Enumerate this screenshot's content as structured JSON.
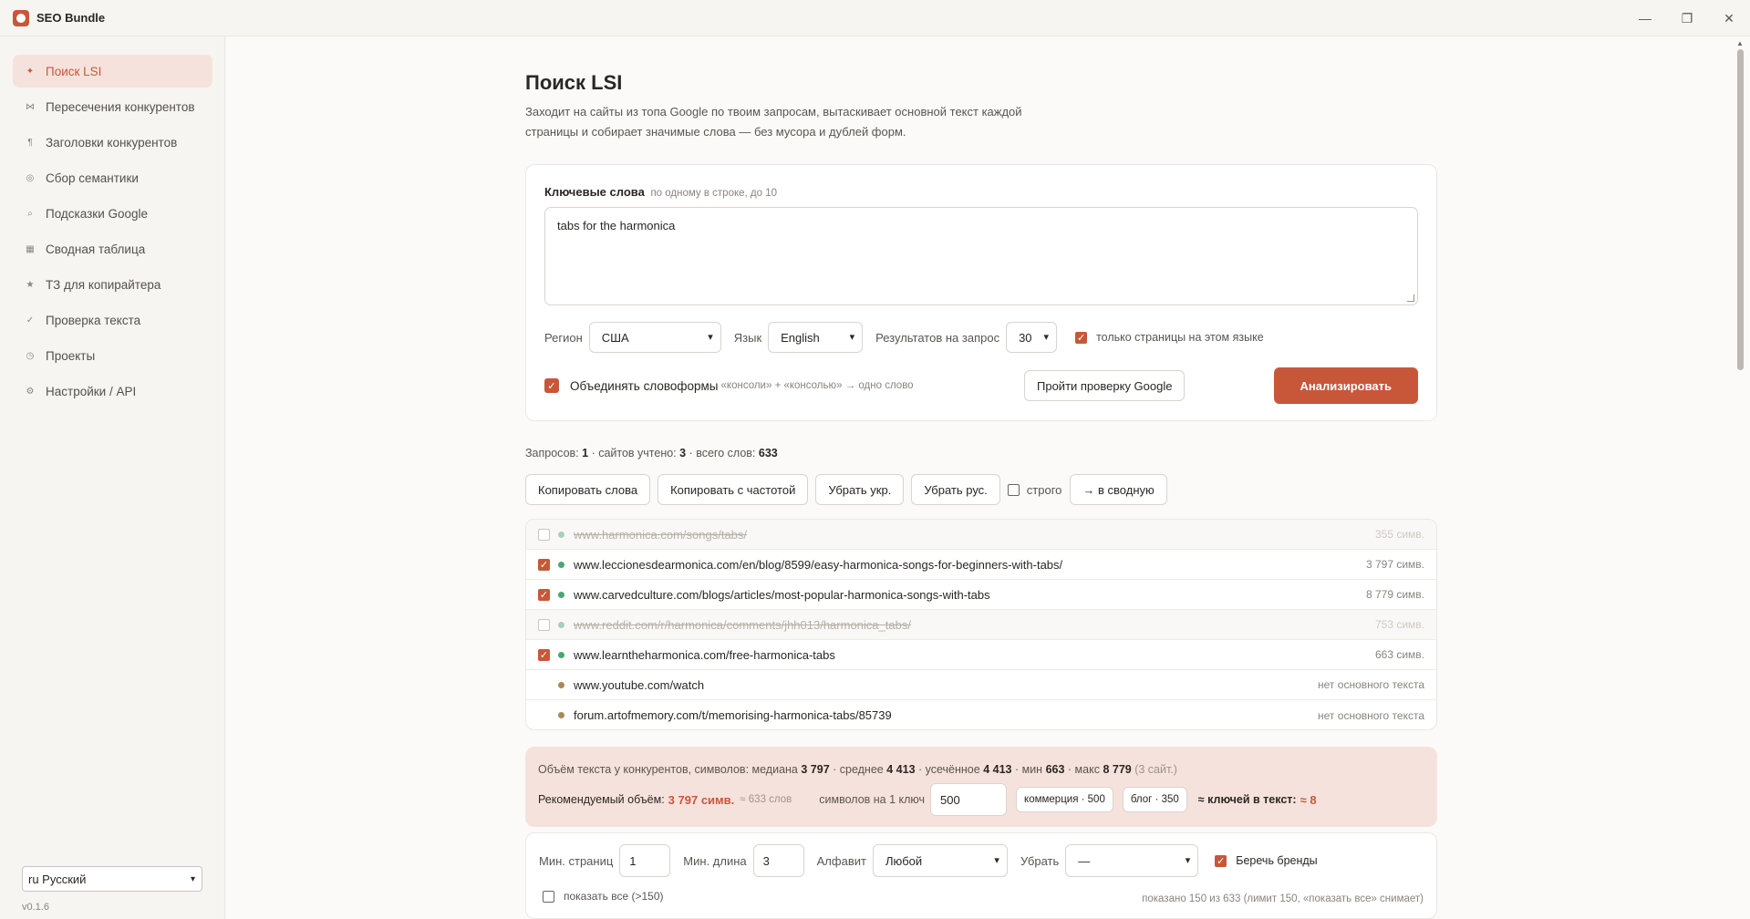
{
  "app": {
    "title": "SEO Bundle",
    "controls": {
      "minimize": "—",
      "maximize": "❐",
      "close": "✕"
    }
  },
  "sidebar": {
    "items": [
      {
        "icon": "sparkle-icon",
        "glyph": "✦",
        "label": "Поиск LSI",
        "active": true
      },
      {
        "icon": "intersect-icon",
        "glyph": "⋈",
        "label": "Пересечения конкурентов"
      },
      {
        "icon": "heading-icon",
        "glyph": "¶",
        "label": "Заголовки конкурентов"
      },
      {
        "icon": "target-icon",
        "glyph": "◎",
        "label": "Сбор семантики"
      },
      {
        "icon": "search-icon",
        "glyph": "⌕",
        "label": "Подсказки Google"
      },
      {
        "icon": "table-icon",
        "glyph": "▦",
        "label": "Сводная таблица"
      },
      {
        "icon": "star-icon",
        "glyph": "★",
        "label": "ТЗ для копирайтера"
      },
      {
        "icon": "check-icon",
        "glyph": "✓",
        "label": "Проверка текста"
      },
      {
        "icon": "clock-icon",
        "glyph": "◷",
        "label": "Проекты"
      },
      {
        "icon": "gear-icon",
        "glyph": "⚙",
        "label": "Настройки / API"
      }
    ],
    "language": "ru Русский",
    "version": "v0.1.6"
  },
  "page": {
    "title": "Поиск LSI",
    "description": "Заходит на сайты из топа Google по твоим запросам, вытаскивает основной текст каждой страницы и собирает значимые слова — без мусора и дублей форм."
  },
  "form": {
    "keywords_label": "Ключевые слова",
    "keywords_hint": "по одному в строке, до 10",
    "keywords_value": "tabs for the harmonica",
    "region_label": "Регион",
    "region_value": "США",
    "language_label": "Язык",
    "language_value": "English",
    "results_label": "Результатов на запрос",
    "results_value": "30",
    "same_lang_label": "только страницы на этом языке",
    "merge_label": "Объединять словоформы",
    "merge_hint": "«консоли» + «консолью» → одно слово",
    "google_check_button": "Пройти проверку Google",
    "analyze_button": "Анализировать"
  },
  "stats": {
    "queries_label": "Запросов:",
    "queries": "1",
    "sites_label": "· сайтов учтено:",
    "sites": "3",
    "words_label": "· всего слов:",
    "words": "633"
  },
  "toolbar": {
    "copy_words": "Копировать слова",
    "copy_freq": "Копировать с частотой",
    "remove_ukr": "Убрать укр.",
    "remove_rus": "Убрать рус.",
    "strict": "строго",
    "to_summary": "→ в сводную"
  },
  "urls": [
    {
      "url": "www.harmonica.com/songs/tabs/",
      "meta": "355 симв.",
      "checked": false,
      "excluded": true,
      "has_checkbox": true,
      "dot": "faint"
    },
    {
      "url": "www.leccionesdearmonica.com/en/blog/8599/easy-harmonica-songs-for-beginners-with-tabs/",
      "meta": "3 797 симв.",
      "checked": true,
      "excluded": false,
      "has_checkbox": true,
      "dot": "green"
    },
    {
      "url": "www.carvedculture.com/blogs/articles/most-popular-harmonica-songs-with-tabs",
      "meta": "8 779 симв.",
      "checked": true,
      "excluded": false,
      "has_checkbox": true,
      "dot": "green"
    },
    {
      "url": "www.reddit.com/r/harmonica/comments/jhh013/harmonica_tabs/",
      "meta": "753 симв.",
      "checked": false,
      "excluded": true,
      "has_checkbox": true,
      "dot": "faint"
    },
    {
      "url": "www.learntheharmonica.com/free-harmonica-tabs",
      "meta": "663 симв.",
      "checked": true,
      "excluded": false,
      "has_checkbox": true,
      "dot": "green"
    },
    {
      "url": "www.youtube.com/watch",
      "meta": "нет основного текста",
      "checked": false,
      "excluded": false,
      "has_checkbox": false,
      "dot": "brown"
    },
    {
      "url": "forum.artofmemory.com/t/memorising-harmonica-tabs/85739",
      "meta": "нет основного текста",
      "checked": false,
      "excluded": false,
      "has_checkbox": false,
      "dot": "brown"
    }
  ],
  "volume": {
    "intro": "Объём текста у конкурентов, символов: медиана",
    "median": "3 797",
    "avg_label": "· среднее",
    "avg": "4 413",
    "trimmed_label": "· усечённое",
    "trimmed": "4 413",
    "min_label": "· мин",
    "min": "663",
    "max_label": "· макс",
    "max": "8 779",
    "sites_note": "(3 сайт.)",
    "recommended_label": "Рекомендуемый объём:",
    "recommended": "3 797 симв.",
    "recommended_words": "≈ 633 слов",
    "per_key_label": "символов на 1 ключ",
    "per_key_value": "500",
    "chip_commerce": "коммерция · 500",
    "chip_blog": "блог · 350",
    "keys_label": "≈ ключей в текст:",
    "keys_value": "≈ 8"
  },
  "filters": {
    "min_pages_label": "Мин. страниц",
    "min_pages": "1",
    "min_length_label": "Мин. длина",
    "min_length": "3",
    "alphabet_label": "Алфавит",
    "alphabet_value": "Любой",
    "remove_label": "Убрать",
    "remove_value": "—",
    "brands_label": "Беречь бренды",
    "show_all_label": "показать все (>150)",
    "shown_info": "показано 150 из 633 (лимит 150, «показать все» снимает)"
  }
}
